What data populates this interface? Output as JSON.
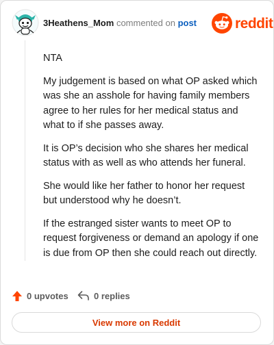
{
  "header": {
    "username": "3Heathens_Mom",
    "commented_on": "commented on",
    "post_link": "post",
    "brand_name": "reddit",
    "brand_color": "#ff4500"
  },
  "comment": {
    "paragraphs": [
      "NTA",
      "My judgement is based on what OP asked which was she an asshole for having family members agree to her rules for her medical status and what to if she passes away.",
      "It is OP’s decision who she shares her medical status with as well as who attends her funeral.",
      "She would like her father to honor her request but understood why he doesn’t.",
      "If the estranged sister wants to meet OP to request forgiveness or demand an apology if one is due from OP then she could reach out directly."
    ]
  },
  "actions": {
    "upvotes": "0 upvotes",
    "replies": "0 replies",
    "upvote_icon": "arrow-up-icon",
    "reply_icon": "reply-arrow-icon",
    "upvote_color": "#ff4500"
  },
  "footer": {
    "view_more": "View more on Reddit",
    "link_color": "#d93900"
  }
}
